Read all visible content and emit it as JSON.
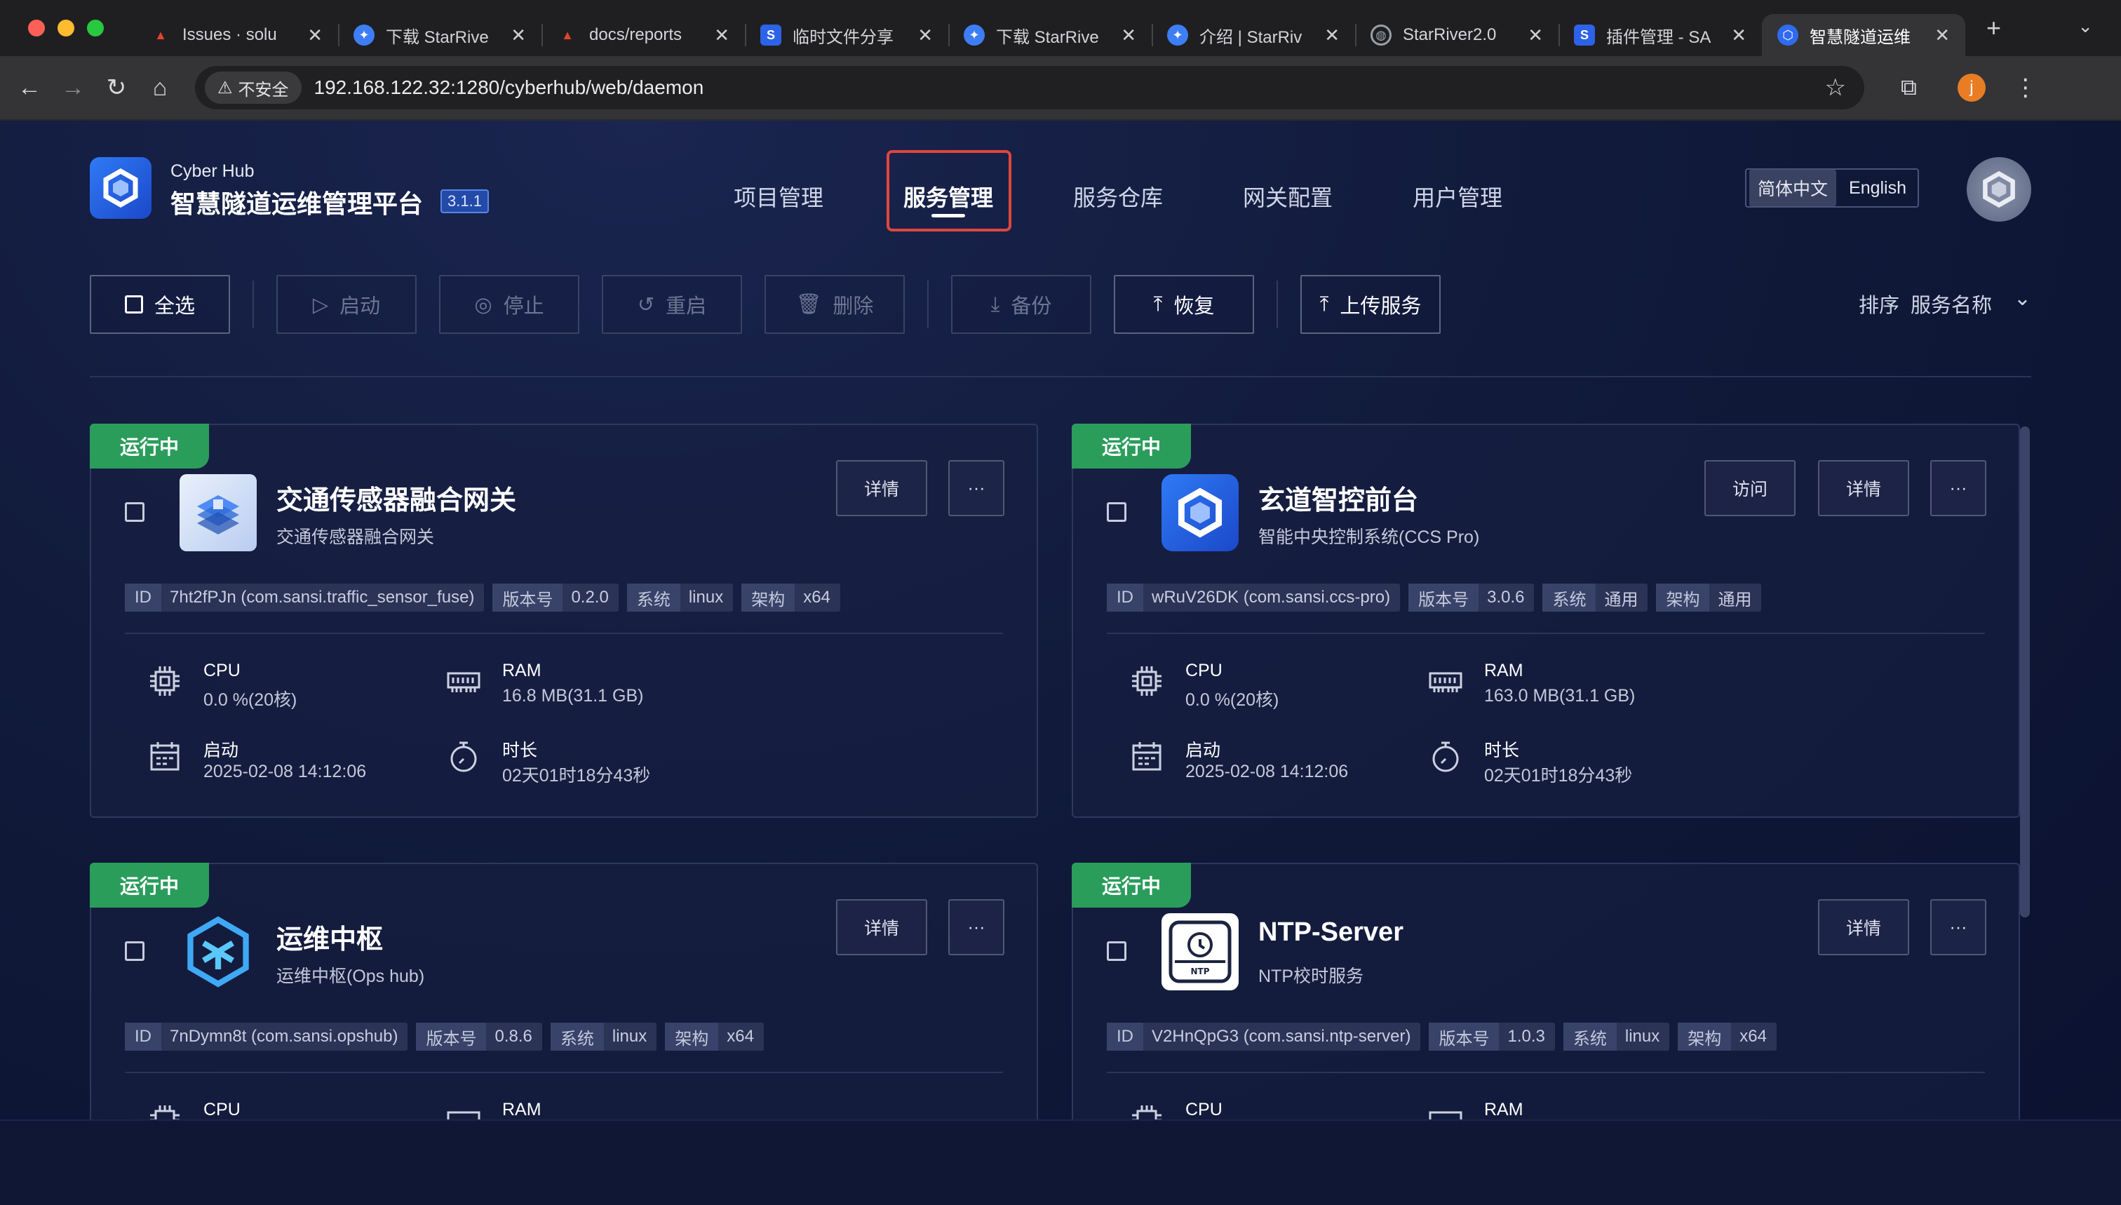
{
  "browser": {
    "tabs": [
      {
        "label": "Issues · solu",
        "fav": "gitlab-icon",
        "color": "#e2432a"
      },
      {
        "label": "下载 StarRive",
        "fav": "starriver-icon",
        "color": "#3d7ef5"
      },
      {
        "label": "docs/reports",
        "fav": "gitlab-icon",
        "color": "#e2432a"
      },
      {
        "label": "临时文件分享",
        "fav": "s-logo-icon",
        "color": "#2d63e8"
      },
      {
        "label": "下载 StarRive",
        "fav": "starriver-icon",
        "color": "#3d7ef5"
      },
      {
        "label": "介绍 | StarRiv",
        "fav": "starriver-icon",
        "color": "#3d7ef5"
      },
      {
        "label": "StarRiver2.0",
        "fav": "globe-icon",
        "color": "#9aa0aa"
      },
      {
        "label": "插件管理 - SA",
        "fav": "s-logo-icon",
        "color": "#2d63e8"
      },
      {
        "label": "智慧隧道运维",
        "fav": "cyberhub-icon",
        "color": "#2f6bf0"
      }
    ],
    "insecure_label": "不安全",
    "url": "192.168.122.32:1280/cyberhub/web/daemon",
    "profile_initial": "j"
  },
  "header": {
    "brand_small": "Cyber Hub",
    "brand_big": "智慧隧道运维管理平台",
    "version": "3.1.1",
    "nav": [
      "项目管理",
      "服务管理",
      "服务仓库",
      "网关配置",
      "用户管理"
    ],
    "active_nav": 1,
    "lang": [
      "简体中文",
      "English"
    ]
  },
  "toolbar": {
    "select_all": "全选",
    "start": "启动",
    "stop": "停止",
    "restart": "重启",
    "delete": "删除",
    "backup": "备份",
    "restore": "恢复",
    "upload": "上传服务",
    "sort_label": "排序",
    "sort_value": "服务名称"
  },
  "labels": {
    "status": "运行中",
    "detail": "详情",
    "visit": "访问",
    "more": "···",
    "id": "ID",
    "version": "版本号",
    "os": "系统",
    "arch": "架构",
    "cpu": "CPU",
    "ram": "RAM",
    "start": "启动",
    "duration": "时长"
  },
  "services": [
    {
      "name": "交通传感器融合网关",
      "desc": "交通传感器融合网关",
      "id": "7ht2fPJn (com.sansi.traffic_sensor_fuse)",
      "version": "0.2.0",
      "os": "linux",
      "arch": "x64",
      "cpu": "0.0 %(20核)",
      "ram": "16.8 MB(31.1 GB)",
      "start": "2025-02-08 14:12:06",
      "duration": "02天01时18分43秒"
    },
    {
      "name": "玄道智控前台",
      "desc": "智能中央控制系统(CCS Pro)",
      "id": "wRuV26DK (com.sansi.ccs-pro)",
      "version": "3.0.6",
      "os": "通用",
      "arch": "通用",
      "cpu": "0.0 %(20核)",
      "ram": "163.0 MB(31.1 GB)",
      "start": "2025-02-08 14:12:06",
      "duration": "02天01时18分43秒"
    },
    {
      "name": "运维中枢",
      "desc": "运维中枢(Ops hub)",
      "id": "7nDymn8t (com.sansi.opshub)",
      "version": "0.8.6",
      "os": "linux",
      "arch": "x64",
      "cpu": "",
      "ram": "",
      "start": "",
      "duration": ""
    },
    {
      "name": "NTP-Server",
      "desc": "NTP校时服务",
      "id": "V2HnQpG3 (com.sansi.ntp-server)",
      "version": "1.0.3",
      "os": "linux",
      "arch": "x64",
      "cpu": "",
      "ram": "",
      "start": "",
      "duration": ""
    }
  ],
  "colors": {
    "running": "#2a9d5b",
    "nav_highlight": "#e0463d",
    "brand_blue": "#2f7af5"
  }
}
